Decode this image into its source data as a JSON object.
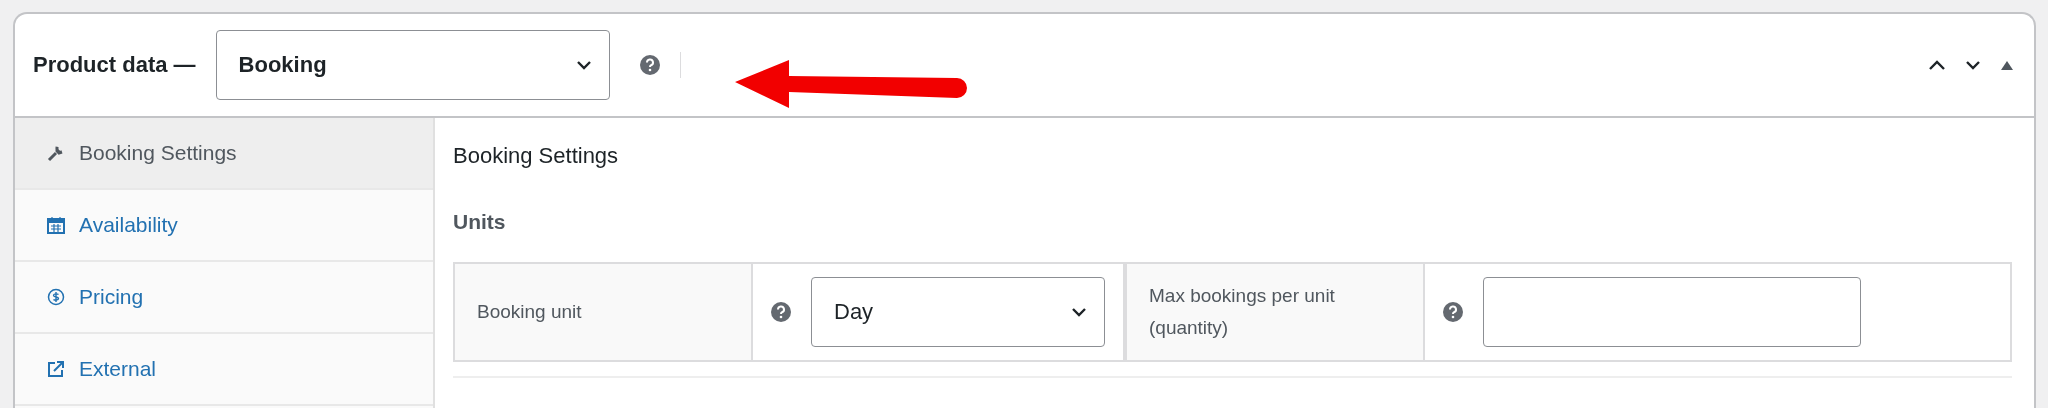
{
  "header": {
    "title": "Product data —",
    "product_type": "Booking"
  },
  "sidebar": {
    "items": [
      {
        "label": "Booking Settings",
        "kind": "wrench",
        "selected": true
      },
      {
        "label": "Availability",
        "kind": "calendar",
        "selected": false
      },
      {
        "label": "Pricing",
        "kind": "dollar",
        "selected": false
      },
      {
        "label": "External",
        "kind": "external",
        "selected": false
      }
    ]
  },
  "content": {
    "title": "Booking Settings",
    "section": "Units",
    "fields": [
      {
        "label": "Booking unit",
        "kind": "select",
        "value": "Day"
      },
      {
        "label": "Max bookings per unit (quantity)",
        "kind": "input"
      }
    ]
  }
}
